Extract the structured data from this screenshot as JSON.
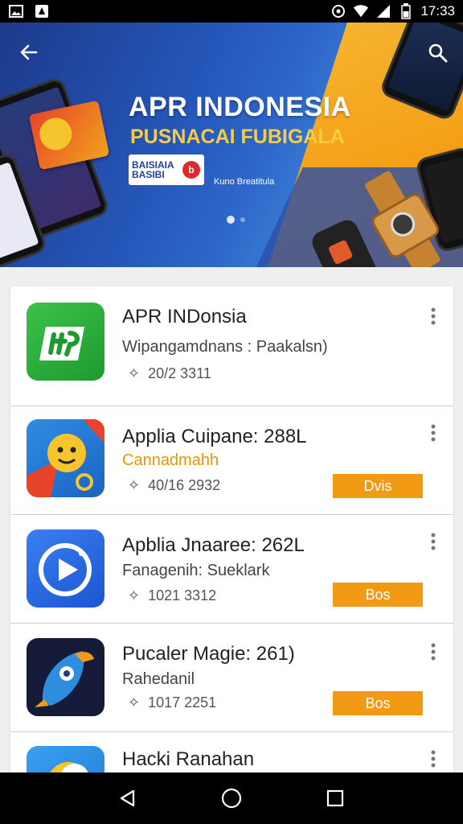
{
  "status_bar": {
    "time": "17:33"
  },
  "banner": {
    "title": "APR INDONESIA",
    "subtitle": "PUSNACAI FUBIGALA",
    "badge_text": "BAISIAIA BASIBI",
    "badge_circle": "b",
    "tagline": "Kuno Breatitula"
  },
  "apps": [
    {
      "name": "APR INDonsia",
      "subtitle": "Wipangamdnans : Paakalsn)",
      "subtitle_color": "#444444",
      "meta": "20/2 3311",
      "button": ""
    },
    {
      "name": "Applia Cuipane: 288L",
      "subtitle": "Cannadmahh",
      "subtitle_color": "#e8930c",
      "meta": "40/16 2932",
      "button": "Dvis"
    },
    {
      "name": "Apblia Jnaaree: 262L",
      "subtitle": "Fanagenih: Sueklark",
      "subtitle_color": "#444444",
      "meta": "1021 3312",
      "button": "Bos"
    },
    {
      "name": "Pucaler Magie: 261)",
      "subtitle": "Rahedanil",
      "subtitle_color": "#444444",
      "meta": "1017 2251",
      "button": "Bos"
    },
    {
      "name": "Hacki Ranahan",
      "subtitle": "",
      "subtitle_color": "#444444",
      "meta": "",
      "button": ""
    }
  ],
  "colors": {
    "accent": "#f29a13",
    "banner_blue": "#2456b8"
  },
  "icons": {
    "status_left": [
      "image-icon",
      "app-notification-icon"
    ],
    "status_right": [
      "data-saver-icon",
      "wifi-icon",
      "signal-icon",
      "battery-icon"
    ],
    "nav": [
      "back-triangle-icon",
      "home-circle-icon",
      "recents-square-icon"
    ]
  }
}
